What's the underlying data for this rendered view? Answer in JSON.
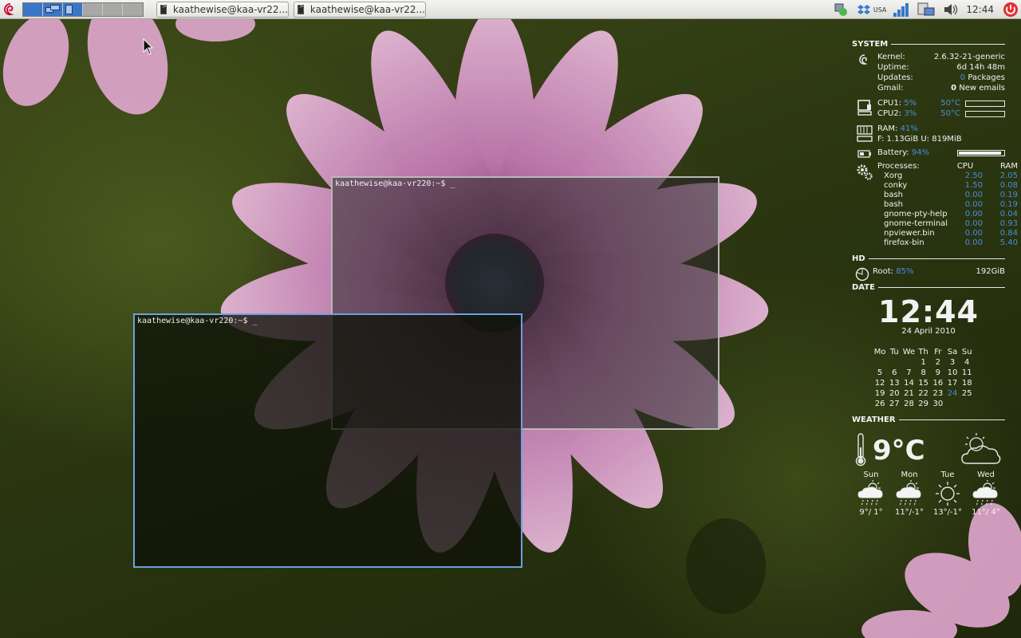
{
  "panel": {
    "tasks": [
      {
        "label": "kaathewise@kaa-vr22..."
      },
      {
        "label": "kaathewise@kaa-vr22..."
      }
    ],
    "keyboard_layout": "USA",
    "clock": "12:44"
  },
  "terminals": [
    {
      "prompt": "kaathewise@kaa-vr220:~$ _"
    },
    {
      "prompt": "kaathewise@kaa-vr220:~$ _"
    }
  ],
  "conky": {
    "system": {
      "heading": "SYSTEM",
      "kernel_label": "Kernel:",
      "kernel": "2.6.32-21-generic",
      "uptime_label": "Uptime:",
      "uptime": "6d 14h 48m",
      "updates_label": "Updates:",
      "updates_count": "0",
      "updates_unit": "Packages",
      "gmail_label": "Gmail:",
      "gmail_count": "0",
      "gmail_unit": "New emails",
      "cpu1_label": "CPU1:",
      "cpu1": "5%",
      "cpu1_temp": "50°C",
      "cpu2_label": "CPU2:",
      "cpu2": "3%",
      "cpu2_temp": "50°C",
      "ram_label": "RAM:",
      "ram": "41%",
      "ram_detail": "F: 1.13GiB U: 819MiB",
      "battery_label": "Battery:",
      "battery": "94%",
      "battery_fraction": 0.94
    },
    "processes": {
      "label": "Processes:",
      "col_cpu": "CPU",
      "col_ram": "RAM",
      "rows": [
        {
          "name": "Xorg",
          "cpu": "2.50",
          "ram": "2.05"
        },
        {
          "name": "conky",
          "cpu": "1.50",
          "ram": "0.08"
        },
        {
          "name": "bash",
          "cpu": "0.00",
          "ram": "0.19"
        },
        {
          "name": "bash",
          "cpu": "0.00",
          "ram": "0.19"
        },
        {
          "name": "gnome-pty-helpe",
          "cpu": "0.00",
          "ram": "0.04"
        },
        {
          "name": "gnome-terminal",
          "cpu": "0.00",
          "ram": "0.93"
        },
        {
          "name": "npviewer.bin",
          "cpu": "0.00",
          "ram": "0.84"
        },
        {
          "name": "firefox-bin",
          "cpu": "0.00",
          "ram": "5.40"
        }
      ]
    },
    "hd": {
      "heading": "HD",
      "root_label": "Root:",
      "root": "85%",
      "size": "192GiB"
    },
    "date": {
      "heading": "DATE",
      "time": "12:44",
      "date": "24 April 2010",
      "weekdays": [
        "Mo",
        "Tu",
        "We",
        "Th",
        "Fr",
        "Sa",
        "Su"
      ],
      "weeks": [
        [
          "",
          "",
          "",
          "1",
          "2",
          "3",
          "4"
        ],
        [
          "5",
          "6",
          "7",
          "8",
          "9",
          "10",
          "11"
        ],
        [
          "12",
          "13",
          "14",
          "15",
          "16",
          "17",
          "18"
        ],
        [
          "19",
          "20",
          "21",
          "22",
          "23",
          "24",
          "25"
        ],
        [
          "26",
          "27",
          "28",
          "29",
          "30",
          "",
          ""
        ]
      ],
      "today": "24"
    },
    "weather": {
      "heading": "WEATHER",
      "temp": "9°C",
      "days": [
        {
          "day": "Sun",
          "temp": "9°/ 1°",
          "icon": "rain-sun-icon"
        },
        {
          "day": "Mon",
          "temp": "11°/-1°",
          "icon": "rain-sun-icon"
        },
        {
          "day": "Tue",
          "temp": "13°/-1°",
          "icon": "sun-icon"
        },
        {
          "day": "Wed",
          "temp": "11°/ 4°",
          "icon": "rain-sun-icon"
        }
      ]
    }
  },
  "colors": {
    "accent_blue": "#4a8cd8",
    "active_workspace": "#3a76c8",
    "active_window_border": "#6ea0e0"
  }
}
